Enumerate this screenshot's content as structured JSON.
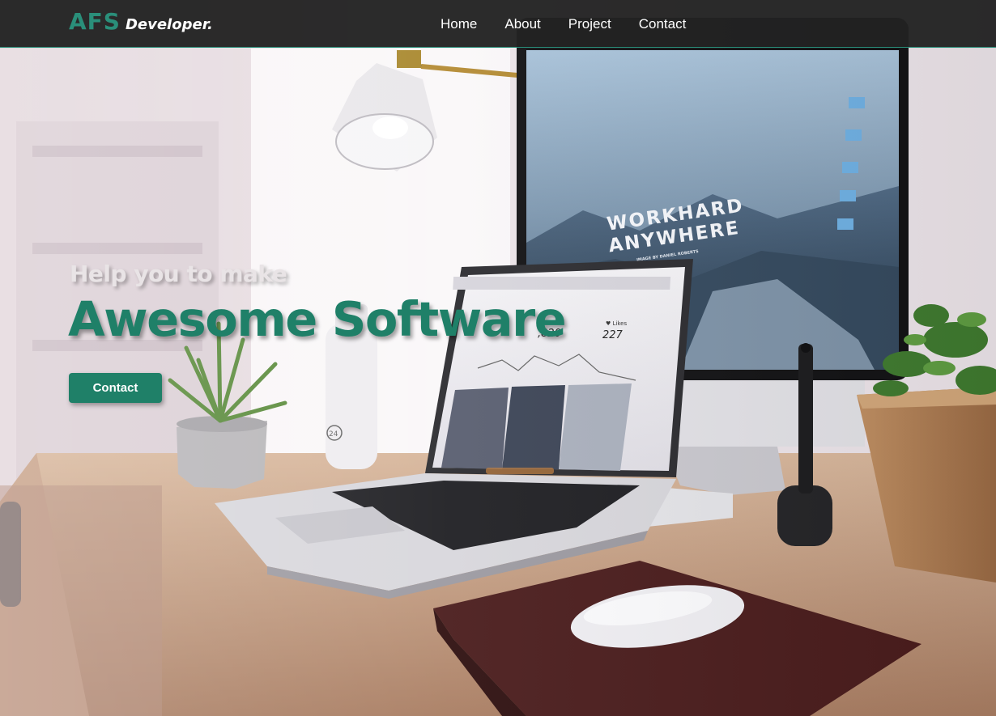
{
  "nav": {
    "brand_primary": "AFS",
    "brand_secondary": "Developer.",
    "links": [
      {
        "label": "Home"
      },
      {
        "label": "About"
      },
      {
        "label": "Project"
      },
      {
        "label": "Contact"
      }
    ]
  },
  "hero": {
    "subtitle": "Help you to make",
    "title": "Awesome Software",
    "cta_label": "Contact"
  },
  "monitor_screen": {
    "line1": "WORKHARD",
    "line2": "ANYWHERE",
    "caption": "IMAGE BY DANIEL ROBERTS"
  },
  "laptop_screen": {
    "stat_likes_label": "♥ Likes",
    "stat_likes_value": "227",
    "stat_downloads_value": ",820"
  },
  "bottle_label": "24",
  "colors": {
    "accent": "#1f8068",
    "brand": "#2a8f7a",
    "navbar": "#222222"
  }
}
